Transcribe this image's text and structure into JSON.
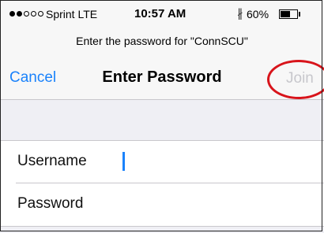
{
  "status_bar": {
    "signal_dots": [
      "on",
      "on",
      "off",
      "off",
      "off"
    ],
    "carrier": "Sprint  LTE",
    "time": "10:57 AM",
    "bluetooth_glyph": "∦",
    "battery_percent": "60%",
    "battery_level": 0.6
  },
  "prompt": "Enter the password for \"ConnSCU\"",
  "nav": {
    "cancel_label": "Cancel",
    "title": "Enter Password",
    "join_label": "Join"
  },
  "form": {
    "username_label": "Username",
    "username_value": "",
    "password_label": "Password",
    "password_value": ""
  },
  "colors": {
    "accent": "#1a82fb",
    "disabled": "#c7c7cc",
    "highlight_circle": "#d8141b"
  }
}
